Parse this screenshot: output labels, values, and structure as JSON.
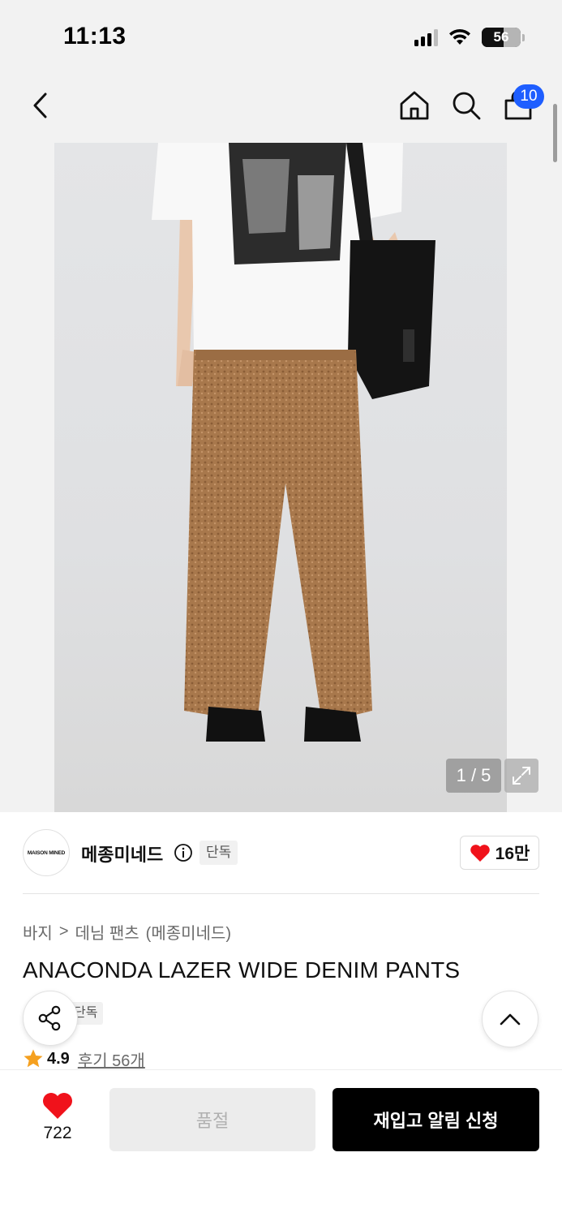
{
  "status_bar": {
    "time": "11:13",
    "battery": "56"
  },
  "nav": {
    "cart_count": "10"
  },
  "gallery": {
    "counter": "1 / 5"
  },
  "brand": {
    "logo_text": "MAISON MINED",
    "name": "메종미네드",
    "tag": "단독",
    "like_count": "16만"
  },
  "product": {
    "breadcrumb": [
      "바지",
      ">",
      "데님 팬츠",
      "(메종미네드)"
    ],
    "title": "ANACONDA LAZER WIDE DENIM PANTS",
    "exclusive_tag": "단독",
    "rating": "4.9",
    "review_link": "후기 56개"
  },
  "bottom_bar": {
    "wish_count": "722",
    "soldout_label": "품절",
    "restock_label": "재입고 알림 신청"
  },
  "colors": {
    "accent_blue": "#1e5eff",
    "heart_red": "#f0121b",
    "star_orange": "#f5a01f",
    "primary_black": "#000000"
  }
}
